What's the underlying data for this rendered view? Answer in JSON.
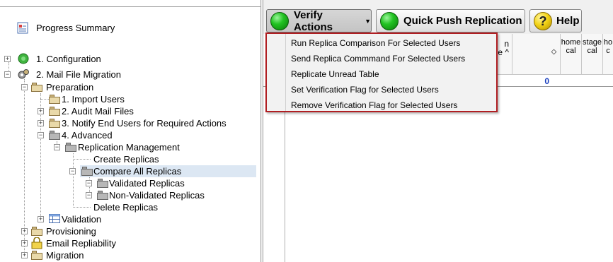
{
  "tree": {
    "progress_summary": "Progress Summary",
    "configuration": "1. Configuration",
    "mail_file_migration": "2. Mail File Migration",
    "preparation": "Preparation",
    "import_users": "1. Import Users",
    "audit_mail_files": "2. Audit Mail Files",
    "notify_end_users": "3. Notify End Users for Required Actions",
    "advanced": "4. Advanced",
    "replication_management": "Replication Management",
    "create_replicas": "Create Replicas",
    "compare_all_replicas": "Compare All Replicas",
    "validated_replicas": "Validated Replicas",
    "non_validated_replicas": "Non-Validated Replicas",
    "delete_replicas": "Delete Replicas",
    "validation": "Validation",
    "provisioning": "Provisioning",
    "email_repliability": "Email Repliability",
    "migration": "Migration"
  },
  "toolbar": {
    "verify_actions": "Verify Actions",
    "quick_push": "Quick Push Replication",
    "help": "Help",
    "help_glyph": "?"
  },
  "grid": {
    "col_partial_1": "n",
    "col_partial_2": "e ^",
    "sort_glyph": "◇",
    "col_home_cal": "home cal",
    "col_stage_cal": "stage cal",
    "col_partial_h": "ho c",
    "row_value": "0"
  },
  "menu": {
    "items": [
      "Run Replica Comparison For Selected Users",
      "Send Replica Commmand For Selected Users",
      "Replicate Unread Table",
      "Set Verification Flag for Selected Users",
      "Remove Verification Flag for Selected Users"
    ]
  },
  "colors": {
    "menu_border": "#b01e22",
    "selection": "#dce7f3",
    "value_blue": "#1a3fbf"
  }
}
